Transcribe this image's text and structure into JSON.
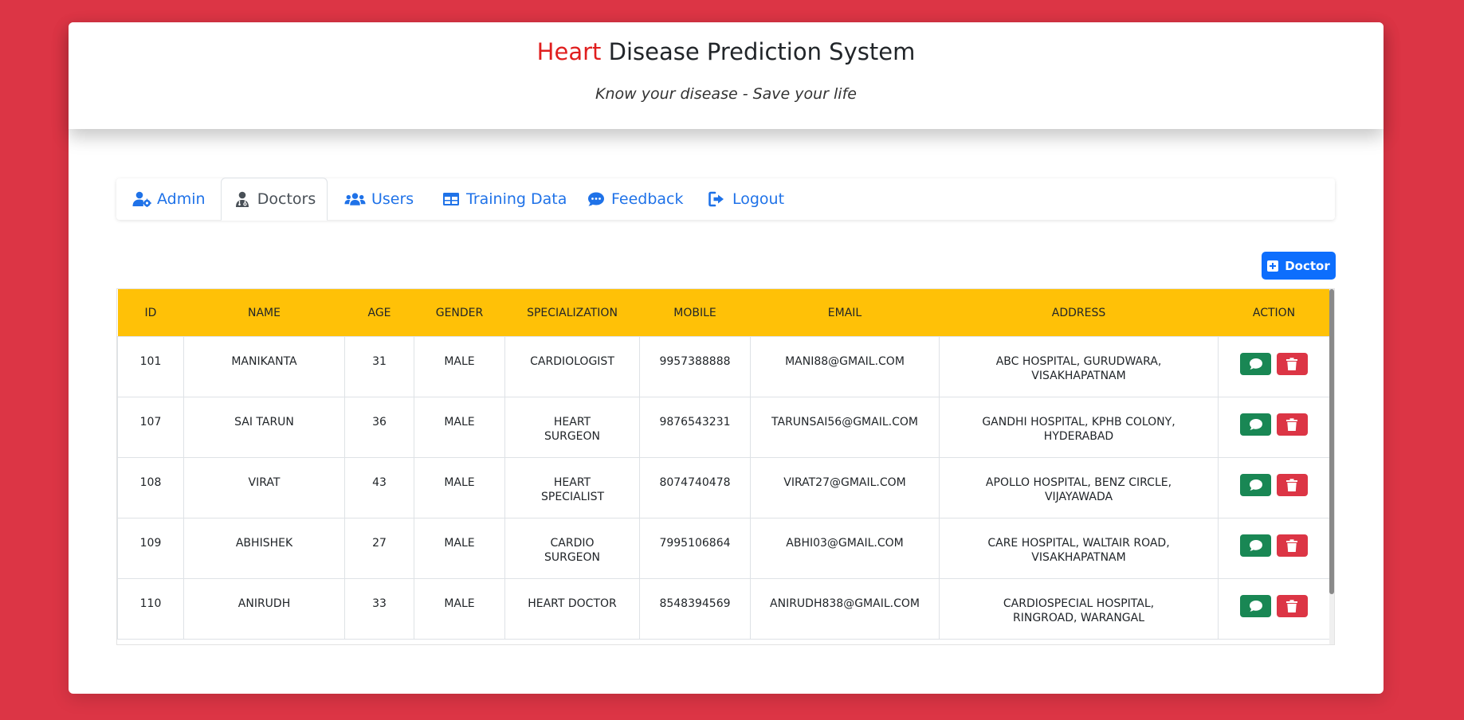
{
  "header": {
    "title_accent": "Heart",
    "title_rest": "Disease Prediction System",
    "tagline": "Know your disease - Save your life"
  },
  "nav": {
    "tabs": [
      {
        "label": "Admin",
        "icon": "user-gear-icon",
        "active": false
      },
      {
        "label": "Doctors",
        "icon": "user-doctor-icon",
        "active": true
      },
      {
        "label": "Users",
        "icon": "users-icon",
        "active": false
      },
      {
        "label": "Training Data",
        "icon": "table-icon",
        "active": false
      },
      {
        "label": "Feedback",
        "icon": "comment-dots-icon",
        "active": false
      },
      {
        "label": "Logout",
        "icon": "logout-icon",
        "active": false
      }
    ]
  },
  "add_button": {
    "label": "Doctor",
    "icon": "plus-square-icon"
  },
  "table": {
    "columns": [
      "ID",
      "NAME",
      "AGE",
      "GENDER",
      "SPECIALIZATION",
      "MOBILE",
      "EMAIL",
      "ADDRESS",
      "ACTION"
    ],
    "rows": [
      {
        "id": "101",
        "name": "MANIKANTA",
        "age": "31",
        "gender": "MALE",
        "specialization": "CARDIOLOGIST",
        "mobile": "9957388888",
        "email": "MANI88@GMAIL.COM",
        "address": "ABC HOSPITAL, GURUDWARA, VISAKHAPATNAM"
      },
      {
        "id": "107",
        "name": "SAI TARUN",
        "age": "36",
        "gender": "MALE",
        "specialization": "HEART SURGEON",
        "mobile": "9876543231",
        "email": "TARUNSAI56@GMAIL.COM",
        "address": "GANDHI HOSPITAL, KPHB COLONY, HYDERABAD"
      },
      {
        "id": "108",
        "name": "VIRAT",
        "age": "43",
        "gender": "MALE",
        "specialization": "HEART SPECIALIST",
        "mobile": "8074740478",
        "email": "VIRAT27@GMAIL.COM",
        "address": "APOLLO HOSPITAL, BENZ CIRCLE, VIJAYAWADA"
      },
      {
        "id": "109",
        "name": "ABHISHEK",
        "age": "27",
        "gender": "MALE",
        "specialization": "CARDIO SURGEON",
        "mobile": "7995106864",
        "email": "ABHI03@GMAIL.COM",
        "address": "CARE HOSPITAL, WALTAIR ROAD, VISAKHAPATNAM"
      },
      {
        "id": "110",
        "name": "ANIRUDH",
        "age": "33",
        "gender": "MALE",
        "specialization": "HEART DOCTOR",
        "mobile": "8548394569",
        "email": "ANIRUDH838@GMAIL.COM",
        "address": "CARDIOSPECIAL HOSPITAL, RINGROAD, WARANGAL"
      }
    ],
    "row_actions": [
      {
        "icon": "comment-icon",
        "color": "#198754"
      },
      {
        "icon": "trash-icon",
        "color": "#dc3545"
      }
    ]
  },
  "colors": {
    "page_background": "#dc3545",
    "title_accent": "#e01e1e",
    "nav_link": "#1f72e8",
    "table_header": "#ffc107",
    "primary_button": "#0d6efd",
    "success_button": "#198754",
    "danger_button": "#dc3545"
  }
}
